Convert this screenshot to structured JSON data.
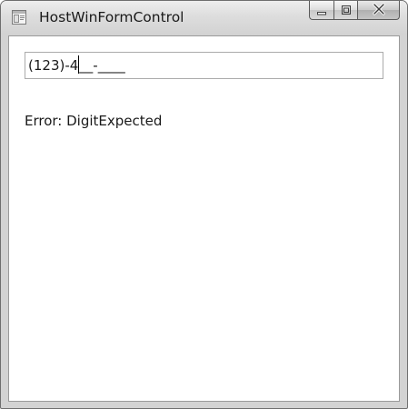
{
  "window": {
    "title": "HostWinFormControl",
    "icon": "application-icon"
  },
  "title_controls": {
    "minimize": "minimize-icon",
    "maximize": "maximize-icon",
    "close": "close-icon"
  },
  "masked_textbox": {
    "value_before_caret": "(123)-4",
    "value_after_caret": "__-____"
  },
  "error": {
    "text": "Error: DigitExpected"
  }
}
